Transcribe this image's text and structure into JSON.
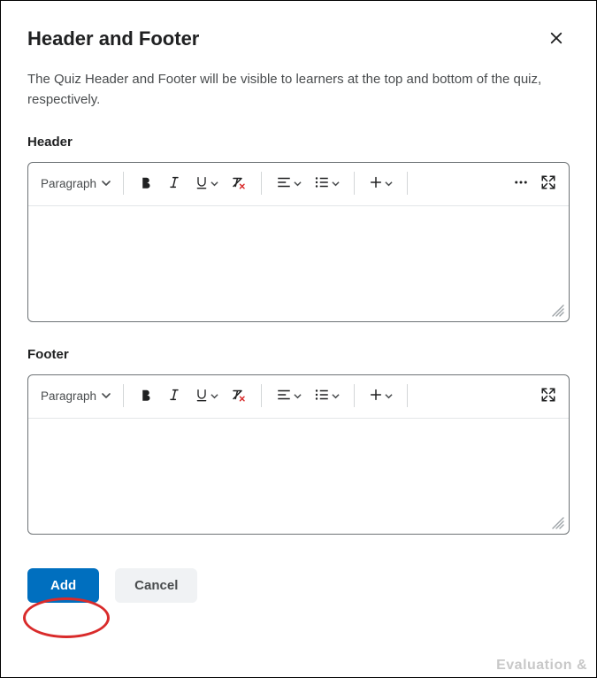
{
  "dialog": {
    "title": "Header and Footer",
    "description": "The Quiz Header and Footer will be visible to learners at the top and bottom of the quiz, respectively."
  },
  "sections": {
    "header_label": "Header",
    "footer_label": "Footer"
  },
  "toolbar": {
    "paragraph_label": "Paragraph"
  },
  "actions": {
    "add_label": "Add",
    "cancel_label": "Cancel"
  },
  "background": {
    "faded_text": "Evaluation &"
  }
}
